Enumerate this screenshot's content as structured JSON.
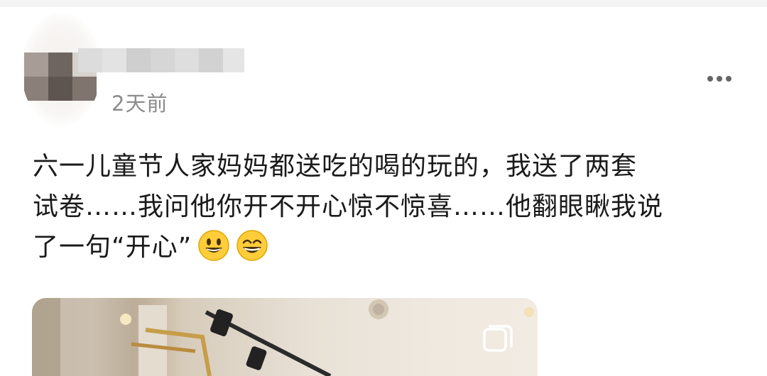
{
  "post": {
    "time_ago": "2天前",
    "content_lines": [
      "六一儿童节人家妈妈都送吃的喝的玩的，我送了两套",
      "试卷……我问他你开不开心惊不惊喜……他翻眼瞅我说",
      "了一句“开心”"
    ],
    "emojis": [
      "smiley-icon",
      "grin-icon"
    ],
    "more_icon": "more-horizontal-icon",
    "image_badge_icon": "multiple-images-icon"
  },
  "colors": {
    "text": "#1a1a1a",
    "time": "#8c8c8c",
    "icon": "#666666",
    "emoji_fill": "#ffcc33"
  }
}
